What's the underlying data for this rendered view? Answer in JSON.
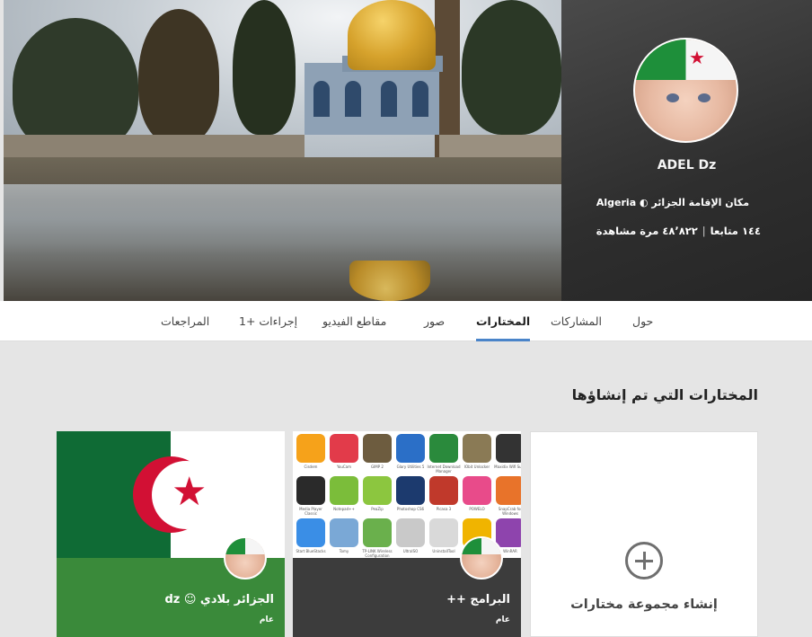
{
  "profile": {
    "name": "ADEL Dz",
    "residence_label": "مكان الإقامة الجزائر",
    "residence_country": "Algeria",
    "followers": "١٤٤ متابعا",
    "views": "٤٨٬٨٢٢ مرة مشاهدة",
    "separator": "|"
  },
  "tabs": [
    {
      "label": "حول"
    },
    {
      "label": "المشاركات"
    },
    {
      "label": "المختارات",
      "active": true
    },
    {
      "label": "صور"
    },
    {
      "label": "مقاطع الفيديو"
    },
    {
      "label": "إجراءات +1"
    },
    {
      "label": "المراجعات"
    }
  ],
  "section": {
    "title": "المختارات التي تم إنشاؤها"
  },
  "cards": {
    "create": {
      "label": "إنشاء مجموعة مختارات"
    },
    "apps": {
      "title": "البرامج ++",
      "visibility": "عام"
    },
    "flag": {
      "title": "الجزائر بلادي ☺ dz",
      "visibility": "عام"
    }
  },
  "apps_grid": [
    {
      "label": "Cisdem",
      "color": "#f6a21a"
    },
    {
      "label": "YouCam",
      "color": "#e23b4a"
    },
    {
      "label": "GIMP 2",
      "color": "#6d5c3f"
    },
    {
      "label": "Glary Utilities 5",
      "color": "#2b6fc7"
    },
    {
      "label": "Internet Download Manager",
      "color": "#2a8a3c"
    },
    {
      "label": "IObit Unlocker",
      "color": "#8a7a55"
    },
    {
      "label": "Maxidix Wifi Suite",
      "color": "#333333"
    },
    {
      "label": "Media Player Classic",
      "color": "#2a2a2a"
    },
    {
      "label": "Notepad++",
      "color": "#7bbd3a"
    },
    {
      "label": "PeaZip",
      "color": "#8cc63f"
    },
    {
      "label": "Photoshop CS6",
      "color": "#1c3a6e"
    },
    {
      "label": "Picasa 3",
      "color": "#c0392b"
    },
    {
      "label": "POWELO",
      "color": "#e84b8a"
    },
    {
      "label": "SnapCrab for Windows",
      "color": "#e8732a"
    },
    {
      "label": "Start BlueStacks",
      "color": "#3a8ee6"
    },
    {
      "label": "Tomy",
      "color": "#7aa8d6"
    },
    {
      "label": "TP-LINK Wireless Configuration Utility",
      "color": "#6ab04c"
    },
    {
      "label": "UltraISO",
      "color": "#c9c9c9"
    },
    {
      "label": "UninstallTool",
      "color": "#d9d9d9"
    },
    {
      "label": "VideoCapture",
      "color": "#f0b400"
    },
    {
      "label": "WinRAR",
      "color": "#8e44ad"
    }
  ]
}
